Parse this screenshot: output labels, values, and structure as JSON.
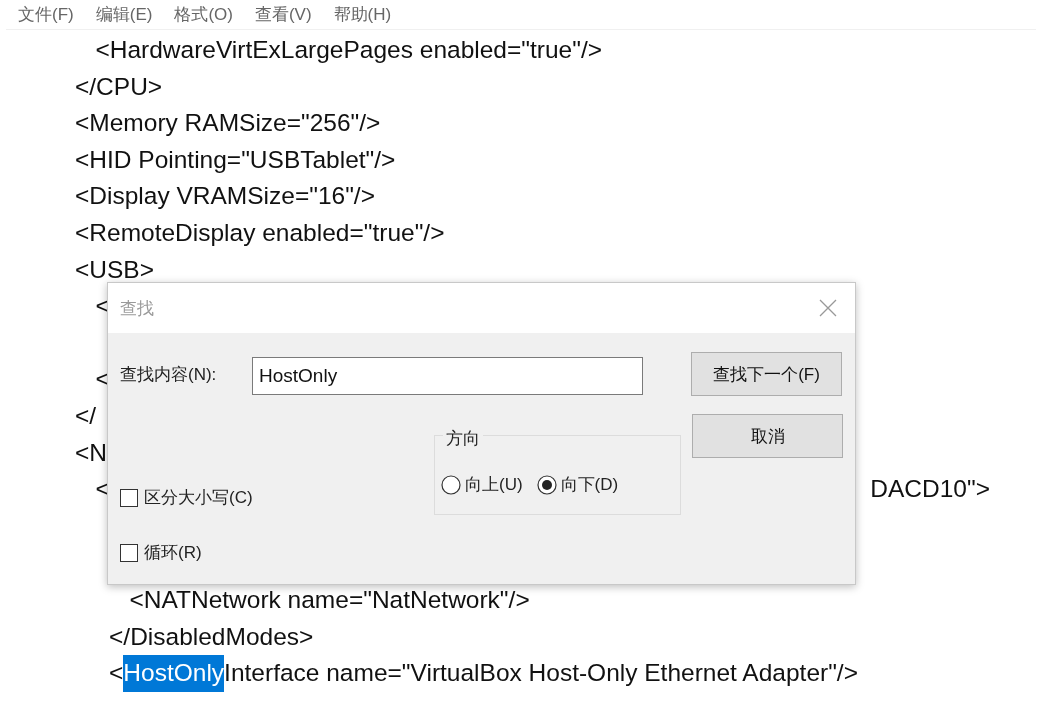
{
  "menu": [
    "文件(F)",
    "编辑(E)",
    "格式(O)",
    "查看(V)",
    "帮助(H)"
  ],
  "editor": {
    "blocks": [
      {
        "lines": [
          {
            "segments": [
              {
                "text": "   <HardwareVirtExLargePages enabled=\"true\"/>",
                "kind": "code",
                "selected": false
              }
            ]
          },
          {
            "segments": [
              {
                "text": "</CPU>",
                "kind": "code",
                "selected": false
              }
            ]
          },
          {
            "segments": [
              {
                "text": "<Memory RAMSize=\"256\"/>",
                "kind": "code",
                "selected": false
              }
            ]
          },
          {
            "segments": [
              {
                "text": "<HID Pointing=\"USBTablet\"/>",
                "kind": "code",
                "selected": false
              }
            ]
          },
          {
            "segments": [
              {
                "text": "<Display VRAMSize=\"16\"/>",
                "kind": "code",
                "selected": false
              }
            ]
          },
          {
            "segments": [
              {
                "text": "<RemoteDisplay enabled=\"true\"/>",
                "kind": "code",
                "selected": false
              }
            ]
          },
          {
            "segments": [
              {
                "text": "<USB>",
                "kind": "code",
                "selected": false
              }
            ]
          },
          {
            "segments": [
              {
                "text": "   <",
                "kind": "code",
                "selected": false
              }
            ]
          }
        ]
      },
      {
        "lines": [
          {
            "segments": [
              {
                "text": "   <",
                "kind": "code",
                "selected": false
              }
            ]
          },
          {
            "segments": [
              {
                "text": "</",
                "kind": "code",
                "selected": false
              }
            ]
          },
          {
            "segments": [
              {
                "text": "<N",
                "kind": "code",
                "selected": false
              }
            ]
          },
          {
            "segments": [
              {
                "text": "   <",
                "kind": "code",
                "selected": false
              },
              {
                "text": "DACD10\">",
                "kind": "tail",
                "selected": false
              }
            ]
          }
        ]
      },
      {
        "lines": [
          {
            "segments": [
              {
                "text": "        <NATNetwork name=\"NatNetwork\"/>",
                "kind": "code",
                "selected": false
              }
            ]
          },
          {
            "segments": [
              {
                "text": "     </DisabledModes>",
                "kind": "code",
                "selected": false
              }
            ]
          },
          {
            "segments": [
              {
                "text": "     <",
                "kind": "code",
                "selected": false
              },
              {
                "text": "HostOnly",
                "kind": "code",
                "selected": true
              },
              {
                "text": "Interface name=\"VirtualBox Host-Only Ethernet Adapter\"/>",
                "kind": "code",
                "selected": false
              }
            ]
          }
        ]
      }
    ]
  },
  "find_dialog": {
    "title": "查找",
    "search_label": "查找内容(N):",
    "search_value": "HostOnly",
    "find_next_button": "查找下一个(F)",
    "cancel_button": "取消",
    "direction": {
      "label": "方向",
      "options": [
        {
          "label": "向上(U)",
          "selected": false
        },
        {
          "label": "向下(D)",
          "selected": true
        }
      ]
    },
    "options": [
      {
        "label": "区分大小写(C)",
        "checked": false
      },
      {
        "label": "循环(R)",
        "checked": false
      }
    ]
  }
}
